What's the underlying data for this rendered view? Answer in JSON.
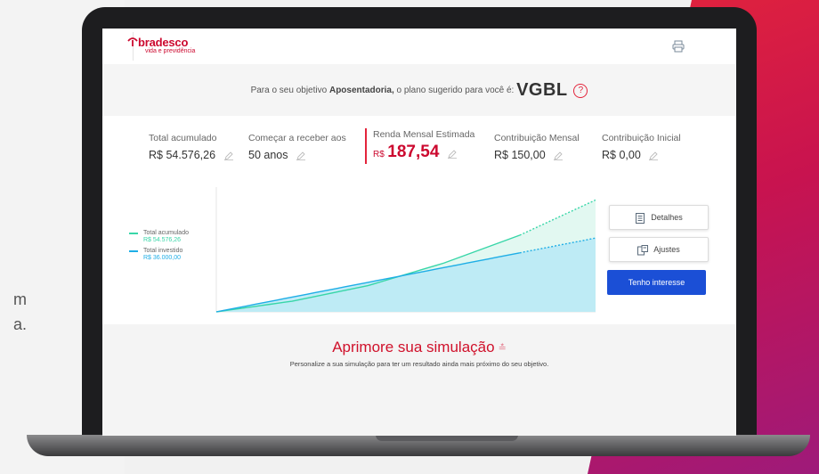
{
  "page_side_text": [
    "m",
    "a."
  ],
  "header": {
    "logo_name": "bradesco",
    "logo_subtitle": "vida e previdência",
    "print_icon": "printer-icon"
  },
  "objective": {
    "prefix": "Para o seu objetivo",
    "goal": "Aposentadoria,",
    "middle": "o plano sugerido para você é:",
    "plan": "VGBL",
    "help_icon": "?"
  },
  "metrics": [
    {
      "label": "Total acumulado",
      "value": "R$ 54.576,26"
    },
    {
      "label": "Começar a receber aos",
      "value": "50 anos"
    },
    {
      "label": "Renda Mensal Estimada",
      "currency": "R$",
      "value": "187,54"
    },
    {
      "label": "Contribuição Mensal",
      "value": "R$ 150,00"
    },
    {
      "label": "Contribuição Inicial",
      "value": "R$ 0,00"
    }
  ],
  "legend": [
    {
      "name": "Total acumulado",
      "value": "R$ 54.576,26",
      "color": "#38d6a8"
    },
    {
      "name": "Total investido",
      "value": "R$ 36.000,00",
      "color": "#1faee6"
    }
  ],
  "chart_data": {
    "type": "area",
    "x": [
      0,
      0.2,
      0.4,
      0.6,
      0.8,
      1.0
    ],
    "series": [
      {
        "name": "Total acumulado",
        "values": [
          0,
          5200,
          12800,
          23800,
          37400,
          54576.26
        ]
      },
      {
        "name": "Total investido",
        "values": [
          0,
          7200,
          14400,
          21600,
          28800,
          36000
        ]
      }
    ],
    "ylim": [
      0,
      60000
    ],
    "grid": false
  },
  "buttons": {
    "details": "Detalhes",
    "adjustments": "Ajustes",
    "interest": "Tenho interesse"
  },
  "improve": {
    "title": "Aprimore sua simulação",
    "subtitle": "Personalize a sua simulação para ter um resultado ainda mais próximo do seu objetivo."
  },
  "colors": {
    "brand_red": "#cc092f",
    "cta_blue": "#1b4fd6",
    "accumulated": "#38d6a8",
    "invested": "#1faee6"
  }
}
